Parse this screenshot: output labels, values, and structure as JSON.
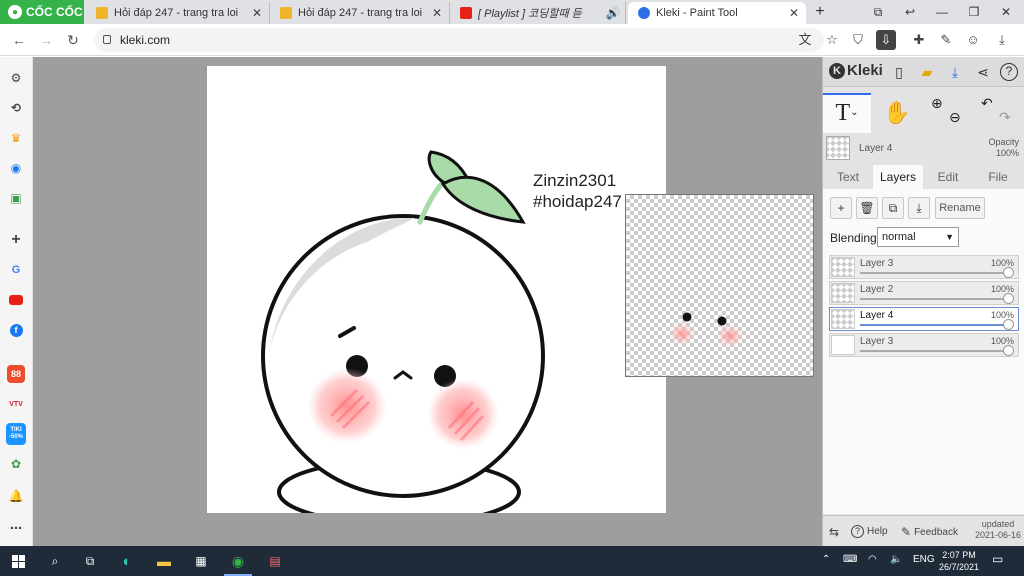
{
  "browser": {
    "brand": "CỐC CỐC",
    "tabs": [
      {
        "title": "Hỏi đáp 247 - trang tra loi",
        "favicon": "hoidap-favicon",
        "active": false
      },
      {
        "title": "Hỏi đáp 247 - trang tra loi",
        "favicon": "hoidap-favicon",
        "active": false
      },
      {
        "title": "[ Playlist ] 코딩할때 듣",
        "favicon": "youtube-favicon",
        "active": false
      },
      {
        "title": "Kleki - Paint Tool",
        "favicon": "kleki-favicon",
        "active": true
      }
    ],
    "new_tab": "+",
    "url": "kleki.com"
  },
  "sidebar_icons": [
    "settings-icon",
    "history-icon",
    "crown-icon",
    "messenger-icon",
    "game-icon",
    "add-icon",
    "google-icon",
    "youtube-icon",
    "facebook-icon",
    "shopee-icon",
    "vtv-icon",
    "tiki-icon",
    "maps-icon",
    "notification-icon",
    "more-icon"
  ],
  "sidebar_labels": {
    "shopee": "88",
    "vtv": "VTV",
    "tiki": "TIKI -50%"
  },
  "canvas": {
    "watermark": "Zinzin2301\n#hoidap247"
  },
  "kleki": {
    "logo": "Kleki",
    "current_layer": "Layer 4",
    "opacity_label": "Opacity",
    "opacity_value": "100%",
    "tabs": [
      "Text",
      "Layers",
      "Edit",
      "File"
    ],
    "active_tab": "Layers",
    "rename_label": "Rename",
    "blending_label": "Blending",
    "blending_value": "normal",
    "layers": [
      {
        "name": "Layer 3",
        "opacity": "100%",
        "selected": false
      },
      {
        "name": "Layer 2",
        "opacity": "100%",
        "selected": false
      },
      {
        "name": "Layer 4",
        "opacity": "100%",
        "selected": true
      },
      {
        "name": "Layer 3",
        "opacity": "100%",
        "selected": false
      }
    ],
    "footer": {
      "help": "Help",
      "feedback": "Feedback",
      "updated_label": "updated",
      "updated_date": "2021-06-16"
    }
  },
  "taskbar": {
    "language": "ENG",
    "time": "2:07 PM",
    "date": "26/7/2021"
  },
  "colors": {
    "brand_green": "#36b24a",
    "accent_blue": "#2d6ee8",
    "taskbar": "#1f2b39",
    "workspace": "#9e9e9e",
    "blush": "#ff8a8a",
    "leaf": "#a8dba8"
  }
}
